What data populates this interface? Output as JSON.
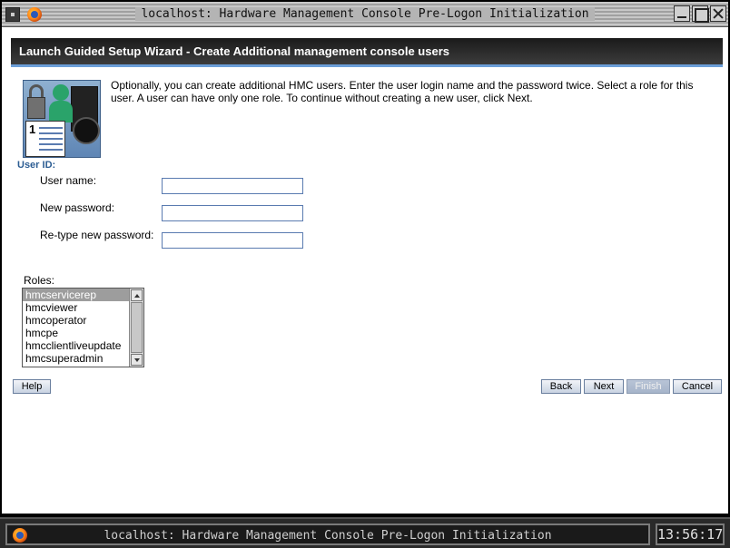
{
  "window": {
    "title": "localhost: Hardware Management Console Pre-Logon Initialization"
  },
  "header": {
    "title": "Launch Guided Setup Wizard - Create Additional management console users"
  },
  "intro_text": "Optionally, you can create additional HMC users. Enter the user login name and the password twice. Select a role for this user. A user can have only one role. To continue without creating a new user, click Next.",
  "user_id": {
    "section_label": "User ID:",
    "username_label": "User name:",
    "username_value": "",
    "new_password_label": "New password:",
    "new_password_value": "",
    "retype_password_label": "Re-type new password:",
    "retype_password_value": ""
  },
  "roles": {
    "label": "Roles:",
    "items": [
      "hmcservicerep",
      "hmcviewer",
      "hmcoperator",
      "hmcpe",
      "hmcclientliveupdate",
      "hmcsuperadmin"
    ],
    "selected": "hmcservicerep"
  },
  "buttons": {
    "help": "Help",
    "back": "Back",
    "next": "Next",
    "finish": "Finish",
    "cancel": "Cancel"
  },
  "taskbar": {
    "task_label": "localhost: Hardware Management Console Pre-Logon Initialization",
    "clock": "13:56:17"
  },
  "colors": {
    "header_accent": "#6b9ed8",
    "section_label": "#2c5d93",
    "selected_item_bg": "#9d9d9d"
  },
  "icons": [
    "window-menu-icon",
    "firefox-icon",
    "minimize-icon",
    "maximize-icon",
    "close-icon",
    "user-setup-illustration"
  ]
}
